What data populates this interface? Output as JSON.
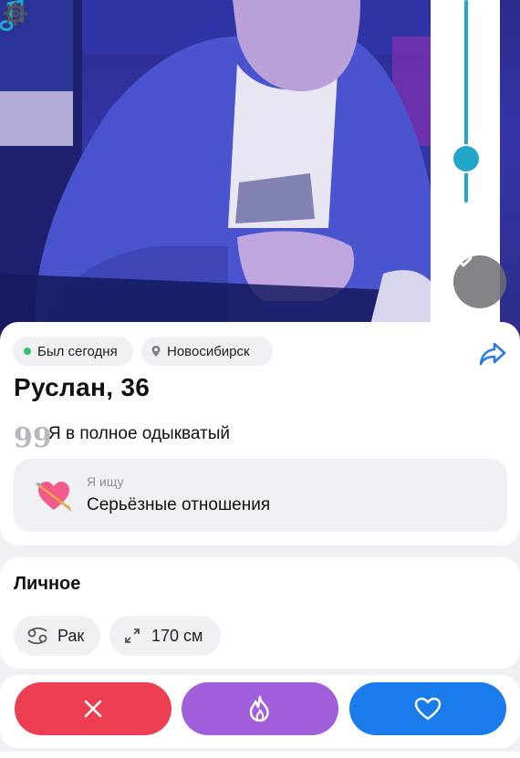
{
  "profile": {
    "status": "Был сегодня",
    "city": "Новосибирск",
    "name_age": "Руслан, 36",
    "about": "Я в полное одыкватый",
    "quote_mark": "99",
    "seeking_label": "Я ищу",
    "seeking_value": "Серьёзные отношения"
  },
  "personal": {
    "title": "Личное",
    "zodiac": "Рак",
    "height": "170 см"
  },
  "icons": {
    "online": "online-dot-icon",
    "location": "location-pin-icon",
    "share": "share-arrow-icon",
    "quote": "quote-icon",
    "seeking": "heart-arrow-icon",
    "zodiac": "cancer-zodiac-icon",
    "height": "expand-arrows-icon",
    "dislike": "close-icon",
    "superlike": "fire-icon",
    "like": "heart-icon",
    "music": "music-note-icon",
    "collapse": "chevron-down-icon",
    "settings": "gear-icon"
  },
  "colors": {
    "dislike": "#ee3f52",
    "superlike": "#a15fdc",
    "like": "#1a7ceb",
    "online": "#2ec36a",
    "accent": "#22a7c9"
  }
}
